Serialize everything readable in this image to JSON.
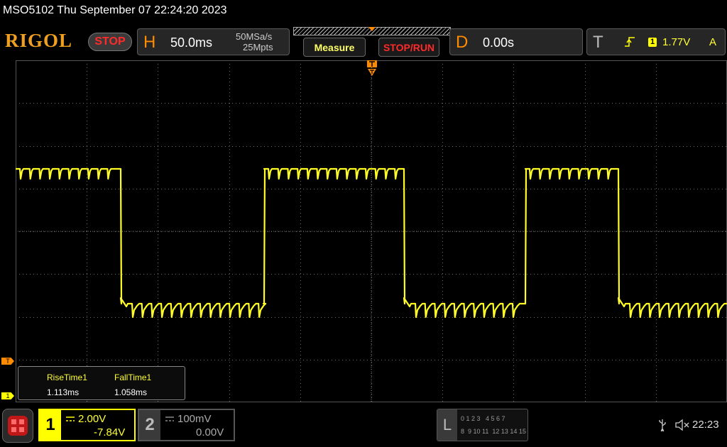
{
  "header": {
    "title": "MSO5102  Thu September 07 22:24:20 2023",
    "logo": "RIGOL",
    "run_state": "STOP"
  },
  "horizontal": {
    "letter": "H",
    "timebase": "50.0ms",
    "sample_rate": "50MSa/s",
    "memory_depth": "25Mpts"
  },
  "buttons": {
    "measure": "Measure",
    "stop_run": "STOP/RUN"
  },
  "delay": {
    "letter": "D",
    "value": "0.00s"
  },
  "trigger": {
    "letter": "T",
    "source": "1",
    "level": "1.77V",
    "mode": "A"
  },
  "markers": {
    "trigger_level": "T",
    "ch1_offset": "1"
  },
  "measurements": [
    {
      "label": "RiseTime1",
      "value": "1.113ms"
    },
    {
      "label": "FallTime1",
      "value": "1.058ms"
    }
  ],
  "channels": {
    "ch1": {
      "number": "1",
      "scale": "2.00V",
      "offset": "-7.84V"
    },
    "ch2": {
      "number": "2",
      "scale": "100mV",
      "offset": "0.00V"
    }
  },
  "logic": {
    "letter": "L",
    "row1": "0 1 2 3   4 5 6 7",
    "row2": "8  9 10 11  12 13 14 15"
  },
  "status": {
    "time": "22:23"
  },
  "colors": {
    "ch1": "#ffff00",
    "accent": "#ff8c00",
    "stop": "#ff2a2a",
    "grid": "#6b6b6b"
  }
}
